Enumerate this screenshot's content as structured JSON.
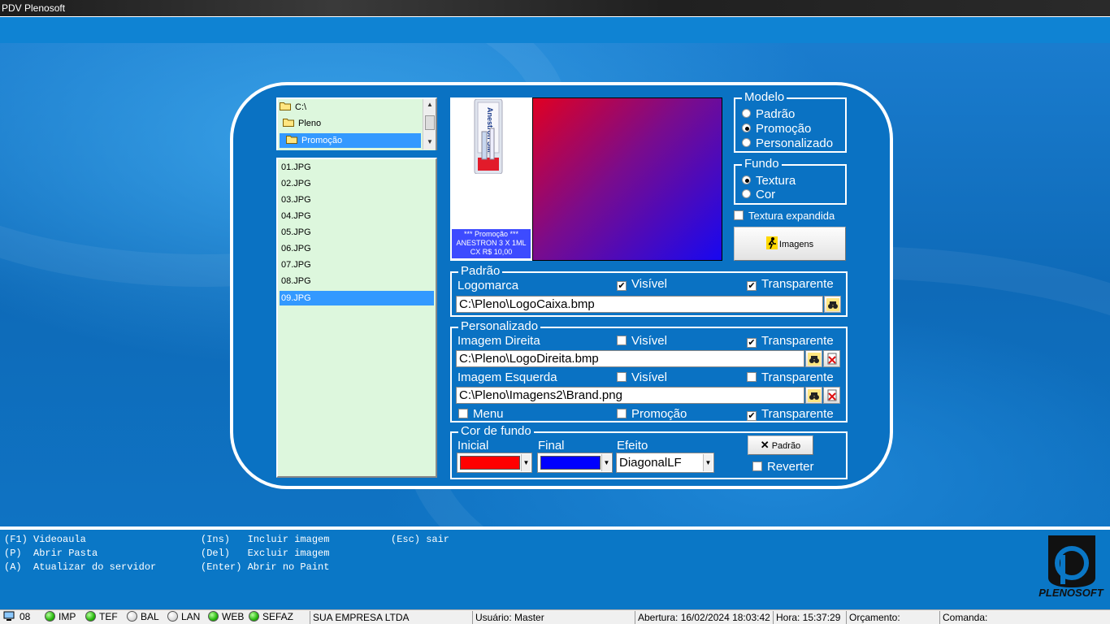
{
  "window": {
    "title": "PDV Plenosoft"
  },
  "folders": {
    "items": [
      {
        "label": "C:\\",
        "selected": false
      },
      {
        "label": "Pleno",
        "selected": false
      },
      {
        "label": "Promoção",
        "selected": true
      }
    ]
  },
  "files": {
    "items": [
      "01.JPG",
      "02.JPG",
      "03.JPG",
      "04.JPG",
      "05.JPG",
      "06.JPG",
      "07.JPG",
      "08.JPG",
      "09.JPG"
    ],
    "selected": "09.JPG"
  },
  "preview": {
    "product_text": "Anestron SM",
    "promo_line1": "*** Promoção ***",
    "promo_line2": "ANESTRON 3 X 1ML",
    "promo_line3": "CX R$ 10,00",
    "gradient_start": "#e00022",
    "gradient_end": "#1808f0"
  },
  "modelo": {
    "title": "Modelo",
    "options": [
      "Padrão",
      "Promoção",
      "Personalizado"
    ],
    "selected": "Promoção"
  },
  "fundo": {
    "title": "Fundo",
    "options": [
      "Textura",
      "Cor"
    ],
    "selected": "Textura"
  },
  "textura_expandida": {
    "label": "Textura expandida",
    "checked": false
  },
  "imagens_button": {
    "label": "Imagens"
  },
  "padrao": {
    "title": "Padrão",
    "logomarca_label": "Logomarca",
    "visivel_label": "Visível",
    "visivel_checked": true,
    "transparente_label": "Transparente",
    "transparente_checked": true,
    "path": "C:\\Pleno\\LogoCaixa.bmp"
  },
  "personalizado": {
    "title": "Personalizado",
    "direita_label": "Imagem Direita",
    "direita_visivel_label": "Visível",
    "direita_visivel_checked": false,
    "direita_transparente_label": "Transparente",
    "direita_transparente_checked": true,
    "direita_path": "C:\\Pleno\\LogoDireita.bmp",
    "esquerda_label": "Imagem Esquerda",
    "esquerda_visivel_label": "Visível",
    "esquerda_visivel_checked": false,
    "esquerda_transparente_label": "Transparente",
    "esquerda_transparente_checked": false,
    "esquerda_path": "C:\\Pleno\\Imagens2\\Brand.png",
    "menu_label": "Menu",
    "menu_checked": false,
    "promocao_label": "Promoção",
    "promocao_checked": false,
    "transparente_label": "Transparente",
    "transparente_checked": true
  },
  "cor_fundo": {
    "title": "Cor de fundo",
    "inicial_label": "Inicial",
    "inicial_color": "#ff0000",
    "final_label": "Final",
    "final_color": "#0000ff",
    "efeito_label": "Efeito",
    "efeito_value": "DiagonalLF",
    "padrao_button": "Padrão",
    "reverter_label": "Reverter",
    "reverter_checked": false
  },
  "shortcuts": {
    "f1": "(F1) Videoaula",
    "p": "(P)  Abrir Pasta",
    "a": "(A)  Atualizar do servidor",
    "ins": "(Ins)   Incluir imagem",
    "del": "(Del)   Excluir imagem",
    "enter": "(Enter) Abrir no Paint",
    "esc": "(Esc) sair"
  },
  "logo": {
    "text": "PLENOSOFT"
  },
  "statusbar": {
    "terminal": "08",
    "indicators": [
      {
        "label": "IMP",
        "status": "green"
      },
      {
        "label": "TEF",
        "status": "green"
      },
      {
        "label": "BAL",
        "status": "grey"
      },
      {
        "label": "LAN",
        "status": "grey"
      },
      {
        "label": "WEB",
        "status": "green"
      },
      {
        "label": "SEFAZ",
        "status": "green"
      }
    ],
    "company": "SUA EMPRESA LTDA",
    "usuario": "Usuário: Master",
    "abertura": "Abertura: 16/02/2024 18:03:42",
    "hora": "Hora: 15:37:29",
    "orcamento": "Orçamento:",
    "comanda": "Comanda:"
  },
  "colors": {
    "accent": "#0a72c3",
    "selection": "#3399ff",
    "list_bg": "#ddf7dd"
  }
}
